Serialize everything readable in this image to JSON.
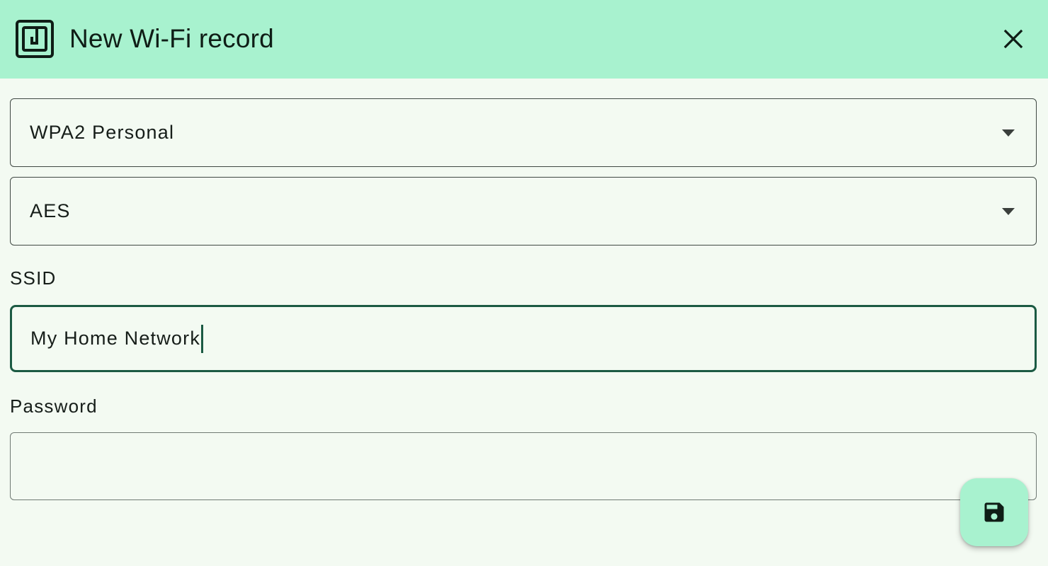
{
  "header": {
    "title": "New Wi-Fi record",
    "app_icon": "nfc-tag-icon",
    "close_icon": "close-icon"
  },
  "form": {
    "security_type": {
      "value": "WPA2 Personal",
      "icon": "dropdown-arrow-icon"
    },
    "encryption": {
      "value": "AES",
      "icon": "dropdown-arrow-icon"
    },
    "ssid": {
      "label": "SSID",
      "value": "My Home Network"
    },
    "password": {
      "label": "Password",
      "value": ""
    }
  },
  "fab": {
    "icon": "save-icon"
  },
  "colors": {
    "accent_container": "#a8f2cf",
    "background": "#f3faf2",
    "focus_border": "#1b5a43",
    "on_surface": "#161d19"
  }
}
